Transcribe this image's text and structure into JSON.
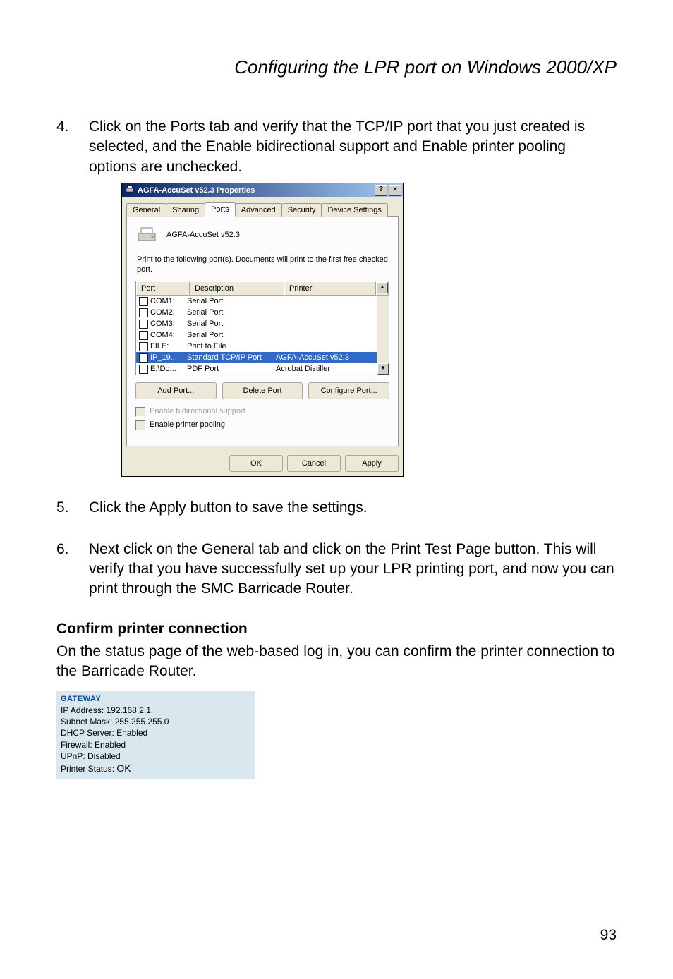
{
  "heading": "Configuring the LPR port on Windows 2000/XP",
  "steps": {
    "s4": {
      "num": "4.",
      "text": "Click on the Ports tab and verify that the TCP/IP port that you just created is selected, and the Enable bidirectional support and Enable printer pooling options are unchecked."
    },
    "s5": {
      "num": "5.",
      "text": "Click the Apply button to save the settings."
    },
    "s6": {
      "num": "6.",
      "text": "Next click on the General tab and click on the Print Test Page button. This will verify that you have successfully set up your LPR printing port, and now you can print through the SMC Barricade Router."
    }
  },
  "dialog": {
    "title": "AGFA-AccuSet v52.3 Properties",
    "help": "?",
    "close": "×",
    "tabs": {
      "general": "General",
      "sharing": "Sharing",
      "ports": "Ports",
      "advanced": "Advanced",
      "security": "Security",
      "device": "Device Settings"
    },
    "printerName": "AGFA-AccuSet v52.3",
    "instruction": "Print to the following port(s). Documents will print to the first free checked port.",
    "columns": {
      "port": "Port",
      "desc": "Description",
      "printer": "Printer"
    },
    "rows": [
      {
        "checked": false,
        "port": "COM1:",
        "desc": "Serial Port",
        "printer": ""
      },
      {
        "checked": false,
        "port": "COM2:",
        "desc": "Serial Port",
        "printer": ""
      },
      {
        "checked": false,
        "port": "COM3:",
        "desc": "Serial Port",
        "printer": ""
      },
      {
        "checked": false,
        "port": "COM4:",
        "desc": "Serial Port",
        "printer": ""
      },
      {
        "checked": false,
        "port": "FILE:",
        "desc": "Print to File",
        "printer": ""
      },
      {
        "checked": true,
        "port": "IP_19...",
        "desc": "Standard TCP/IP Port",
        "printer": "AGFA-AccuSet v52.3",
        "selected": true
      },
      {
        "checked": false,
        "port": "E:\\Do...",
        "desc": "PDF Port",
        "printer": "Acrobat Distiller"
      }
    ],
    "buttons": {
      "add": "Add Port...",
      "delete": "Delete Port",
      "configure": "Configure Port..."
    },
    "checks": {
      "bidi": "Enable bidirectional support",
      "pool": "Enable printer pooling"
    },
    "footer": {
      "ok": "OK",
      "cancel": "Cancel",
      "apply": "Apply"
    }
  },
  "section": {
    "title": "Confirm printer connection",
    "para": "On the status page of the web-based log in, you can confirm the printer connection to the Barricade Router."
  },
  "status": {
    "gateway": "GATEWAY",
    "ip": "IP Address:  192.168.2.1",
    "mask": "Subnet Mask:  255.255.255.0",
    "dhcp": "DHCP Server:  Enabled",
    "firewall": "Firewall:  Enabled",
    "upnp": "UPnP:  Disabled",
    "pstatus_label": "Printer Status: ",
    "pstatus_value": "OK"
  },
  "pageNumber": "93"
}
